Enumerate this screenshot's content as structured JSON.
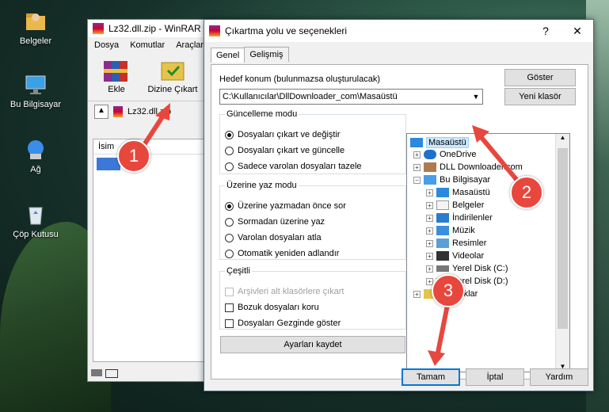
{
  "desktop": {
    "icons": [
      {
        "label": "Belgeler"
      },
      {
        "label": "Bu Bilgisayar"
      },
      {
        "label": "Ağ"
      },
      {
        "label": "Çöp Kutusu"
      }
    ]
  },
  "winrar": {
    "title": "Lz32.dll.zip - WinRAR",
    "menu": [
      "Dosya",
      "Komutlar",
      "Araçlar"
    ],
    "toolbar": {
      "add_label": "Ekle",
      "extract_label": "Dizine Çıkart"
    },
    "address": "Lz32.dll.zip",
    "list_header": "İsim"
  },
  "dialog": {
    "title": "Çıkartma yolu ve seçenekleri",
    "help": "?",
    "close": "✕",
    "tabs": [
      "Genel",
      "Gelişmiş"
    ],
    "dest_label": "Hedef konum (bulunmazsa oluşturulacak)",
    "dest_value": "C:\\Kullanıcılar\\DllDownloader_com\\Masaüstü",
    "show_button": "Göster",
    "new_folder_button": "Yeni klasör",
    "update_mode": {
      "legend": "Güncelleme modu",
      "options": [
        "Dosyaları çıkart ve değiştir",
        "Dosyaları çıkart ve güncelle",
        "Sadece varolan dosyaları tazele"
      ],
      "selected": 0
    },
    "overwrite_mode": {
      "legend": "Üzerine yaz modu",
      "options": [
        "Üzerine yazmadan önce sor",
        "Sormadan üzerine yaz",
        "Varolan dosyaları atla",
        "Otomatik yeniden adlandır"
      ],
      "selected": 0
    },
    "misc": {
      "legend": "Çeşitli",
      "options": [
        "Arşivleri alt klasörlere çıkart",
        "Bozuk dosyaları koru",
        "Dosyaları Gezginde göster"
      ]
    },
    "save_settings": "Ayarları kaydet",
    "tree": {
      "root": "Masaüstü",
      "items": [
        "OneDrive",
        "DLL Downloader.com",
        "Bu Bilgisayar",
        "Masaüstü",
        "Belgeler",
        "İndirilenler",
        "Müzik",
        "Resimler",
        "Videolar",
        "Yerel Disk (C:)",
        "Yerel Disk (D:)",
        "Kitaplıklar"
      ]
    },
    "ok": "Tamam",
    "cancel": "İptal",
    "help_button": "Yardım"
  },
  "callouts": [
    "1",
    "2",
    "3"
  ],
  "colors": {
    "callout": "#e8473d",
    "selection": "#cce8ff",
    "default_border": "#0078d7"
  }
}
